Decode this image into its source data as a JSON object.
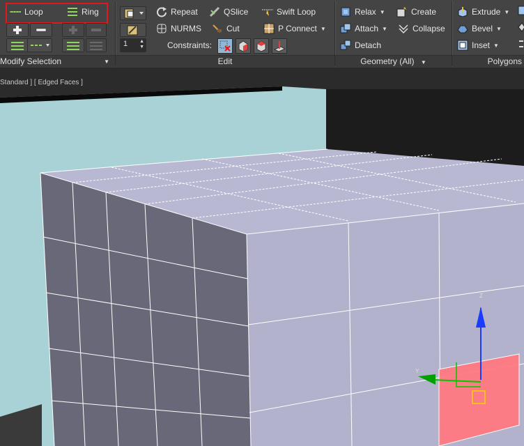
{
  "modify_selection": {
    "loop_label": "Loop",
    "ring_label": "Ring",
    "footer": "Modify Selection"
  },
  "edit": {
    "repeat_label": "Repeat",
    "qslice_label": "QSlice",
    "swift_loop_label": "Swift Loop",
    "nurms_label": "NURMS",
    "cut_label": "Cut",
    "p_connect_label": "P Connect",
    "constraints_label": "Constraints:",
    "spinner_value": "1",
    "footer": "Edit"
  },
  "geometry": {
    "relax_label": "Relax",
    "create_label": "Create",
    "attach_label": "Attach",
    "collapse_label": "Collapse",
    "detach_label": "Detach",
    "footer": "Geometry (All)"
  },
  "polygons": {
    "extrude_label": "Extrude",
    "bevel_label": "Bevel",
    "inset_label": "Inset",
    "footer": "Polygons"
  },
  "viewport": {
    "label": "Standard ] [ Edged Faces ]",
    "gizmo_axes": [
      "Z",
      "Y"
    ]
  },
  "colors": {
    "highlight": "#e0191f",
    "ribbon_bg": "#444444",
    "mesh_side": "#686878",
    "mesh_front": "#b2b2cc",
    "mesh_top": "#b8b8d2",
    "backdrop": "#a8d2d6",
    "gizmo_plane": "#ff7a82"
  }
}
